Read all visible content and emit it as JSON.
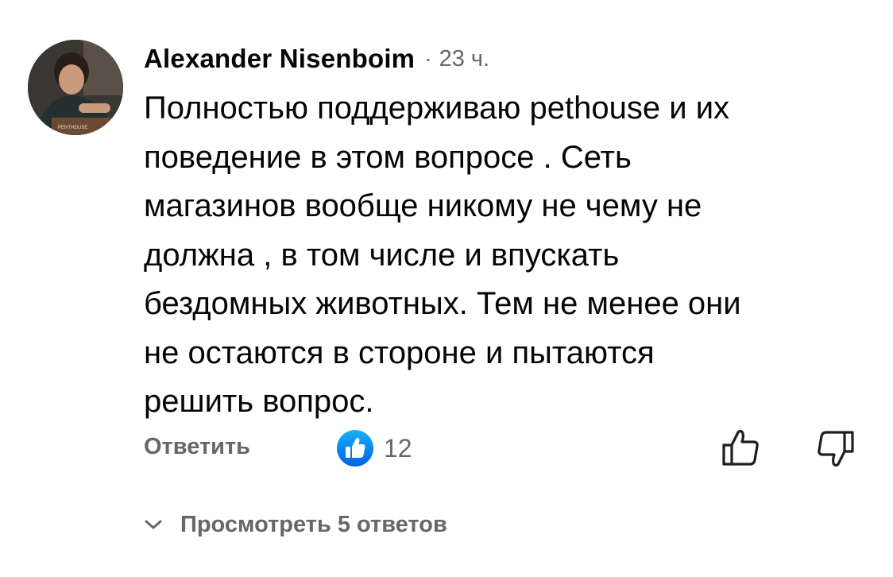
{
  "comment": {
    "author": "Alexander Nisenboim",
    "separator": "·",
    "time": "23 ч.",
    "text": "Полностью поддерживаю pethouse и их\nповедение в этом вопросе . Сеть\nмагазинов вообще никому не чему не\nдолжна , в том числе и впускать\nбездомных животных. Тем не менее они\nне остаются в стороне и пытаются\nрешить вопрос.",
    "avatar_label": "PENTHOUSE"
  },
  "actions": {
    "reply_label": "Ответить",
    "reaction_icon": "like-reaction-icon",
    "reaction_count": "12",
    "like_icon": "thumbs-up-icon",
    "dislike_icon": "thumbs-down-icon"
  },
  "replies": {
    "view_label": "Просмотреть 5 ответов",
    "icon": "chevron-down-icon"
  },
  "colors": {
    "text_primary": "#050505",
    "text_secondary": "#65676b",
    "like_blue": "#1b74e4"
  }
}
